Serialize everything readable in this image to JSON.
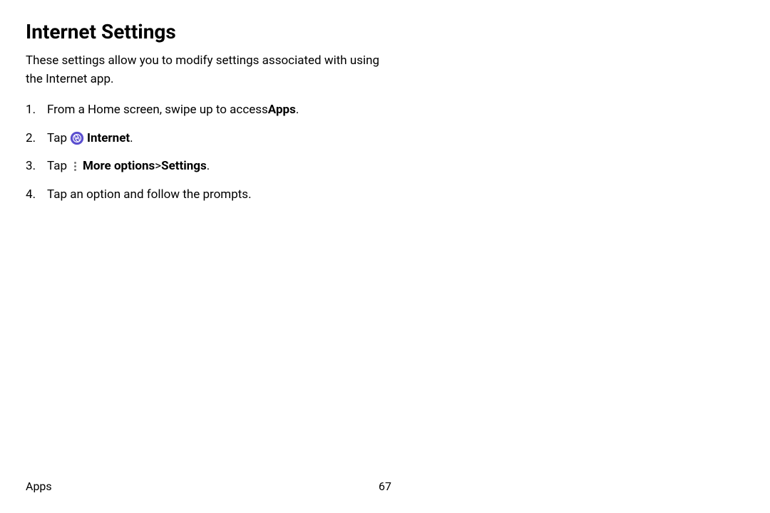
{
  "heading": "Internet Settings",
  "intro": "These settings allow you to modify settings associated with using the Internet app.",
  "steps": {
    "s1_pre": "From a Home screen, swipe up to access ",
    "s1_bold": "Apps",
    "s1_post": ".",
    "s2_pre": "Tap ",
    "s2_bold": "Internet",
    "s2_post": ".",
    "s3_pre": "Tap ",
    "s3_bold1": "More options",
    "s3_sep": " > ",
    "s3_bold2": "Settings",
    "s3_post": ".",
    "s4": "Tap an option and follow the prompts."
  },
  "footer": {
    "section": "Apps",
    "page": "67"
  }
}
